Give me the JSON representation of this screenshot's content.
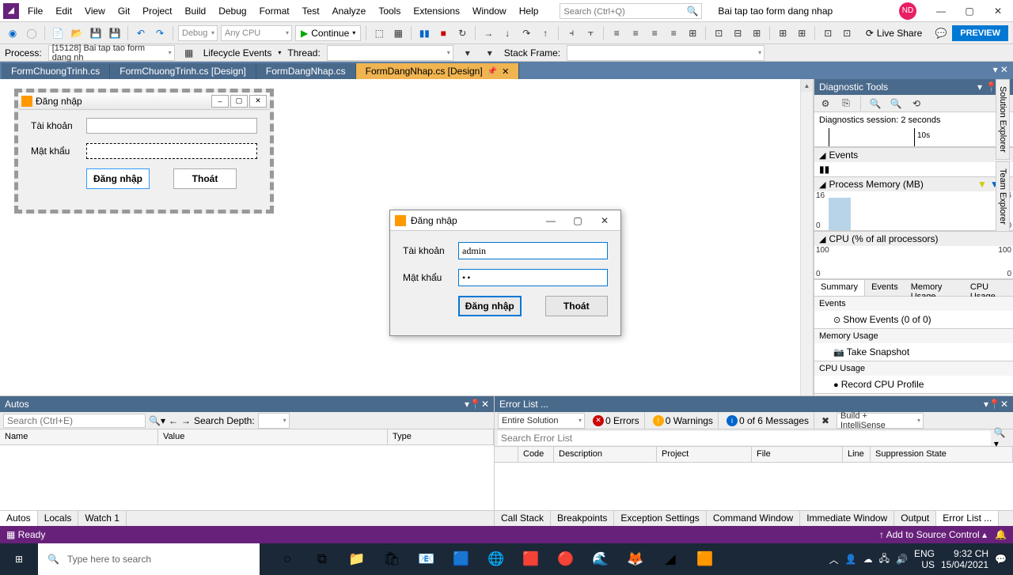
{
  "menubar": [
    "File",
    "Edit",
    "View",
    "Git",
    "Project",
    "Build",
    "Debug",
    "Format",
    "Test",
    "Analyze",
    "Tools",
    "Extensions",
    "Window",
    "Help"
  ],
  "search_placeholder": "Search (Ctrl+Q)",
  "solution_name": "Bai tap tao form dang nhap",
  "avatar": "ND",
  "toolbar": {
    "debug_combo": "Debug",
    "platform_combo": "Any CPU",
    "continue": "Continue",
    "live_share": "Live Share",
    "preview": "PREVIEW"
  },
  "toolbar2": {
    "process_label": "Process:",
    "process_value": "[15128] Bai tap tao form dang nh",
    "lifecycle": "Lifecycle Events",
    "thread": "Thread:",
    "stackframe": "Stack Frame:"
  },
  "doc_tabs": [
    {
      "label": "FormChuongTrinh.cs",
      "active": false
    },
    {
      "label": "FormChuongTrinh.cs [Design]",
      "active": false
    },
    {
      "label": "FormDangNhap.cs",
      "active": false
    },
    {
      "label": "FormDangNhap.cs [Design]",
      "active": true
    }
  ],
  "design_form": {
    "title": "Đăng nhập",
    "lbl_user": "Tài khoản",
    "lbl_pass": "Mật khẩu",
    "btn_login": "Đăng nhập",
    "btn_exit": "Thoát"
  },
  "runtime_form": {
    "title": "Đăng nhập",
    "lbl_user": "Tài khoản",
    "lbl_pass": "Mật khẩu",
    "user_value": "admin",
    "pass_value": "••",
    "btn_login": "Đăng nhập",
    "btn_exit": "Thoát"
  },
  "diag": {
    "title": "Diagnostic Tools",
    "session": "Diagnostics session: 2 seconds",
    "time_tick": "10s",
    "events": "Events",
    "mem": "Process Memory (MB)",
    "mem_y": "16",
    "mem_y0": "0",
    "cpu": "CPU (% of all processors)",
    "cpu_y": "100",
    "cpu_y0": "0",
    "tabs": [
      "Summary",
      "Events",
      "Memory Usage",
      "CPU Usage"
    ],
    "card_events": "Events",
    "show_events": "Show Events (0 of 0)",
    "card_mem": "Memory Usage",
    "snapshot": "Take Snapshot",
    "card_cpu": "CPU Usage",
    "record": "Record CPU Profile"
  },
  "right_tabs": [
    "Solution Explorer",
    "Team Explorer"
  ],
  "autos": {
    "title": "Autos",
    "search_ph": "Search (Ctrl+E)",
    "depth": "Search Depth:",
    "cols": [
      "Name",
      "Value",
      "Type"
    ],
    "tabs": [
      "Autos",
      "Locals",
      "Watch 1"
    ]
  },
  "errlist": {
    "title": "Error List ...",
    "scope": "Entire Solution",
    "errors": "0 Errors",
    "warnings": "0 Warnings",
    "messages": "0 of 6 Messages",
    "build": "Build + IntelliSense",
    "search_ph": "Search Error List",
    "cols": [
      "",
      "Code",
      "Description",
      "Project",
      "File",
      "Line",
      "Suppression State"
    ],
    "tabs": [
      "Call Stack",
      "Breakpoints",
      "Exception Settings",
      "Command Window",
      "Immediate Window",
      "Output",
      "Error List ..."
    ]
  },
  "statusbar": {
    "ready": "Ready",
    "source_control": "Add to Source Control"
  },
  "taskbar": {
    "search": "Type here to search",
    "lang1": "ENG",
    "lang2": "US",
    "time": "9:32 CH",
    "date": "15/04/2021"
  }
}
